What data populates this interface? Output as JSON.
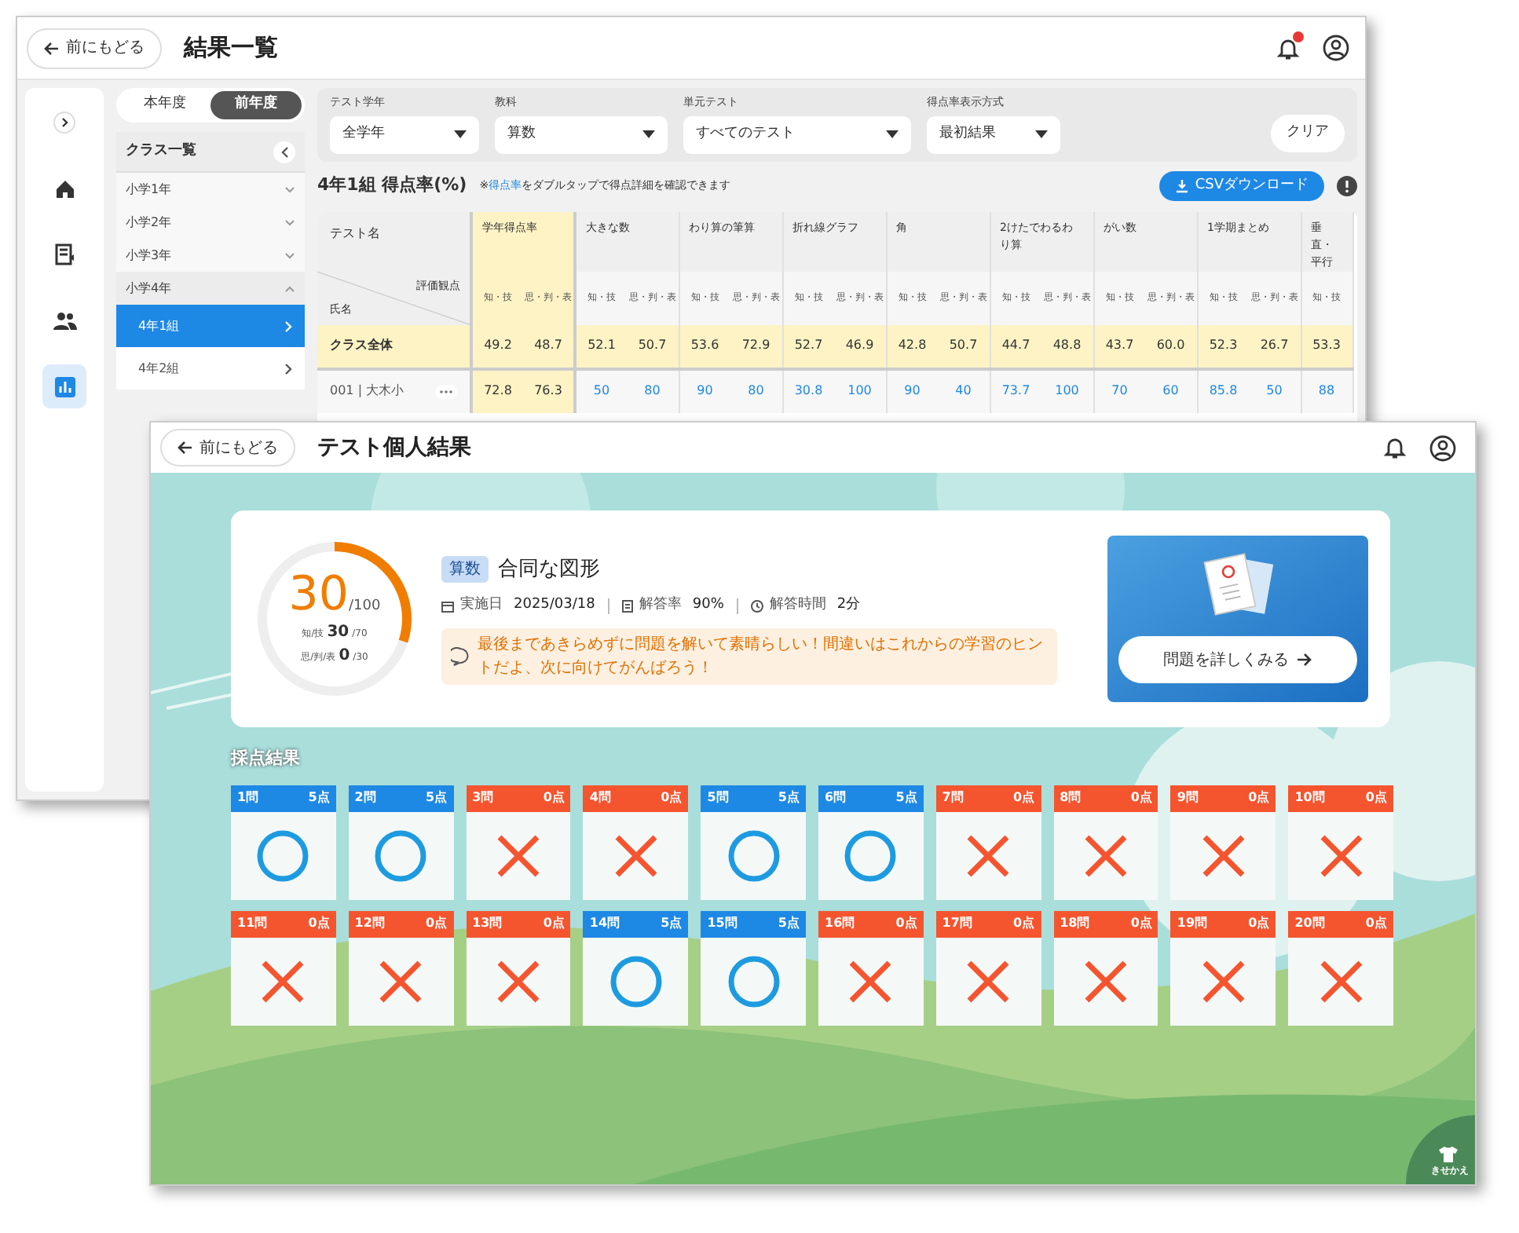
{
  "back_window": {
    "back_button": "前にもどる",
    "title": "結果一覧",
    "notification": true,
    "nav": [
      {
        "kind": "expand",
        "selected": false
      },
      {
        "kind": "home",
        "selected": false
      },
      {
        "kind": "book",
        "selected": false
      },
      {
        "kind": "people",
        "selected": false
      },
      {
        "kind": "chart",
        "selected": true
      }
    ],
    "year_tabs": [
      {
        "label": "本年度",
        "selected": false
      },
      {
        "label": "前年度",
        "selected": true
      }
    ],
    "class_list": {
      "title": "クラス一覧",
      "items": [
        {
          "label": "小学1年",
          "expanded": false
        },
        {
          "label": "小学2年",
          "expanded": false
        },
        {
          "label": "小学3年",
          "expanded": false
        },
        {
          "label": "小学4年",
          "expanded": true,
          "children": [
            {
              "label": "4年1組",
              "selected": true
            },
            {
              "label": "4年2組",
              "selected": false
            }
          ]
        }
      ]
    },
    "filters": [
      {
        "label": "テスト学年",
        "value": "全学年"
      },
      {
        "label": "教科",
        "value": "算数"
      },
      {
        "label": "単元テスト",
        "value": "すべてのテスト"
      },
      {
        "label": "得点率表示方式",
        "value": "最初結果"
      }
    ],
    "clear_button": "クリア",
    "table_title": "4年1組 得点率(%)",
    "note_prefix": "※",
    "note_link": "得点率",
    "note": "をダブルタップで得点詳細を確認できます",
    "csv_button": "CSVダウンロード",
    "table": {
      "name_header": "テスト名",
      "corner_top": "評価観点",
      "corner_bottom": "氏名",
      "groups": [
        {
          "name": "学年得点率",
          "kind": "summary",
          "subs": [
            "知・技",
            "思・判・表"
          ]
        },
        {
          "name": "大きな数",
          "kind": "test",
          "subs": [
            "知・技",
            "思・判・表"
          ]
        },
        {
          "name": "わり算の筆算",
          "kind": "test",
          "subs": [
            "知・技",
            "思・判・表"
          ]
        },
        {
          "name": "折れ線グラフ",
          "kind": "test",
          "subs": [
            "知・技",
            "思・判・表"
          ]
        },
        {
          "name": "角",
          "kind": "test",
          "subs": [
            "知・技",
            "思・判・表"
          ]
        },
        {
          "name": "2けたでわるわり算",
          "kind": "test",
          "subs": [
            "知・技",
            "思・判・表"
          ]
        },
        {
          "name": "がい数",
          "kind": "test",
          "subs": [
            "知・技",
            "思・判・表"
          ]
        },
        {
          "name": "1学期まとめ",
          "kind": "test",
          "subs": [
            "知・技",
            "思・判・表"
          ]
        },
        {
          "name": "垂直・平行",
          "kind": "test",
          "subs": [
            "知・技"
          ]
        }
      ],
      "rows": [
        {
          "name": "クラス全体",
          "kind": "summary",
          "values": [
            "49.2",
            "48.7",
            "52.1",
            "50.7",
            "53.6",
            "72.9",
            "52.7",
            "46.9",
            "42.8",
            "50.7",
            "44.7",
            "48.8",
            "43.7",
            "60.0",
            "52.3",
            "26.7",
            "53.3"
          ]
        },
        {
          "name": "001 | 大木小",
          "kind": "student",
          "values": [
            "72.8",
            "76.3",
            "50",
            "80",
            "90",
            "80",
            "30.8",
            "100",
            "90",
            "40",
            "73.7",
            "100",
            "70",
            "60",
            "85.8",
            "50",
            "88"
          ]
        }
      ]
    }
  },
  "front_window": {
    "back_button": "前にもどる",
    "title": "テスト個人結果",
    "score": {
      "value": "30",
      "total": "/100",
      "level": 0.3,
      "breakdown": [
        {
          "label": "知/技",
          "value": "30",
          "total": "/70"
        },
        {
          "label": "思/判/表",
          "value": "0",
          "total": "/30"
        }
      ]
    },
    "subject": "算数",
    "test_name": "合同な図形",
    "meta": [
      {
        "kind": "date",
        "label": "実施日",
        "value": "2025/03/18"
      },
      {
        "kind": "rate",
        "label": "解答率",
        "value": "90%"
      },
      {
        "kind": "time",
        "label": "解答時間",
        "value": "2分"
      }
    ],
    "message": "最後まであきらめずに問題を解いて素晴らしい！間違いはこれからの学習のヒントだよ、次に向けてがんばろう！",
    "detail_button": "問題を詳しくみる",
    "results_title": "採点結果",
    "questions": [
      {
        "label": "1問",
        "points": "5点",
        "correct": true
      },
      {
        "label": "2問",
        "points": "5点",
        "correct": true
      },
      {
        "label": "3問",
        "points": "0点",
        "correct": false
      },
      {
        "label": "4問",
        "points": "0点",
        "correct": false
      },
      {
        "label": "5問",
        "points": "5点",
        "correct": true
      },
      {
        "label": "6問",
        "points": "5点",
        "correct": true
      },
      {
        "label": "7問",
        "points": "0点",
        "correct": false
      },
      {
        "label": "8問",
        "points": "0点",
        "correct": false
      },
      {
        "label": "9問",
        "points": "0点",
        "correct": false
      },
      {
        "label": "10問",
        "points": "0点",
        "correct": false
      },
      {
        "label": "11問",
        "points": "0点",
        "correct": false
      },
      {
        "label": "12問",
        "points": "0点",
        "correct": false
      },
      {
        "label": "13問",
        "points": "0点",
        "correct": false
      },
      {
        "label": "14問",
        "points": "5点",
        "correct": true
      },
      {
        "label": "15問",
        "points": "5点",
        "correct": true
      },
      {
        "label": "16問",
        "points": "0点",
        "correct": false
      },
      {
        "label": "17問",
        "points": "0点",
        "correct": false
      },
      {
        "label": "18問",
        "points": "0点",
        "correct": false
      },
      {
        "label": "19問",
        "points": "0点",
        "correct": false
      },
      {
        "label": "20問",
        "points": "0点",
        "correct": false
      }
    ],
    "dress_up_button": "きせかえ"
  }
}
